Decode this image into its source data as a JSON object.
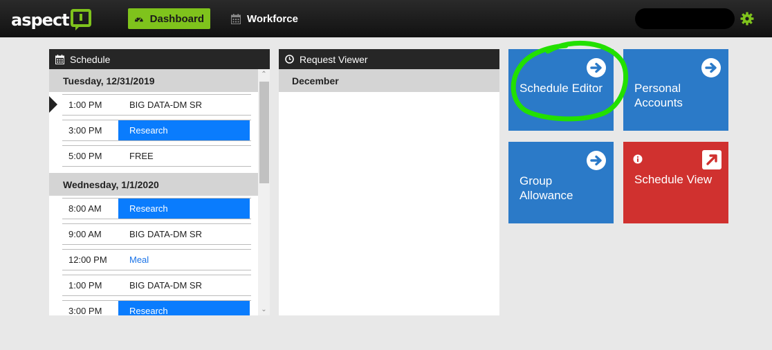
{
  "header": {
    "logo_text": "aspect",
    "nav": [
      {
        "label": "Dashboard",
        "icon": "speedometer-icon",
        "active": true
      },
      {
        "label": "Workforce",
        "icon": "calendar-icon",
        "active": false
      }
    ],
    "settings_icon": "gear-icon",
    "accent_color": "#7fc31c"
  },
  "schedule": {
    "title": "Schedule",
    "days": [
      {
        "date": "Tuesday, 12/31/2019",
        "items": [
          {
            "time": "1:00 PM",
            "activity": "BIG DATA-DM SR",
            "style": "plain",
            "current": true
          },
          {
            "time": "3:00 PM",
            "activity": "Research",
            "style": "blue"
          },
          {
            "time": "5:00 PM",
            "activity": "FREE",
            "style": "plain"
          }
        ]
      },
      {
        "date": "Wednesday, 1/1/2020",
        "items": [
          {
            "time": "8:00 AM",
            "activity": "Research",
            "style": "blue"
          },
          {
            "time": "9:00 AM",
            "activity": "BIG DATA-DM SR",
            "style": "plain"
          },
          {
            "time": "12:00 PM",
            "activity": "Meal",
            "style": "link"
          },
          {
            "time": "1:00 PM",
            "activity": "BIG DATA-DM SR",
            "style": "plain"
          },
          {
            "time": "3:00 PM",
            "activity": "Research",
            "style": "blue"
          }
        ]
      }
    ]
  },
  "request_viewer": {
    "title": "Request Viewer",
    "month": "December"
  },
  "tiles": [
    {
      "label": "Schedule Editor",
      "color": "#2b7ac8",
      "icon": "arrow-right-circle-icon"
    },
    {
      "label": "Personal Accounts",
      "color": "#2b7ac8",
      "icon": "arrow-right-circle-icon"
    },
    {
      "label": "Group Allowance",
      "color": "#2b7ac8",
      "icon": "arrow-right-circle-icon"
    },
    {
      "label": "Schedule View",
      "color": "#d0312f",
      "icon": "external-link-icon"
    }
  ]
}
